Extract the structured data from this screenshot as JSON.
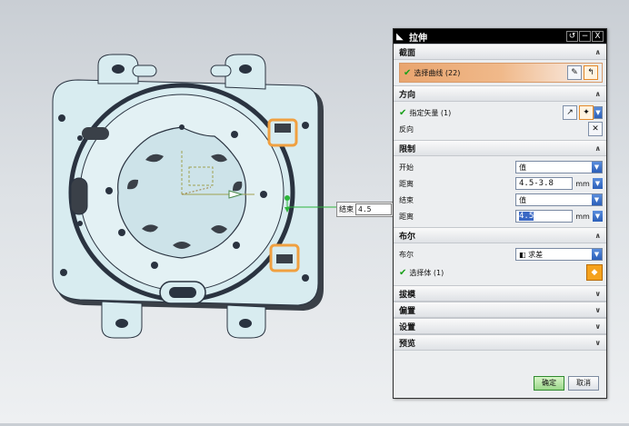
{
  "dialog": {
    "title": "拉伸",
    "title_buttons": {
      "reset": "↺",
      "minimize": "−",
      "close": "X"
    },
    "sections": {
      "section_curve": {
        "label": "截面",
        "selected_curve_label": "选择曲线 (22)"
      },
      "direction": {
        "label": "方向",
        "specify_vector_label": "指定矢量 (1)",
        "reverse_label": "反向"
      },
      "limits": {
        "label": "限制",
        "start_label": "开始",
        "start_value": "值",
        "start_distance_label": "距离",
        "start_distance_value": "4.5-3.8",
        "start_unit": "mm",
        "end_label": "结束",
        "end_value": "值",
        "end_distance_label": "距离",
        "end_distance_value": "4.5",
        "end_unit": "mm"
      },
      "boolean": {
        "label": "布尔",
        "boolean_label": "布尔",
        "boolean_value": "求差",
        "select_body_label": "选择体 (1)"
      },
      "draft": {
        "label": "拔模"
      },
      "offset": {
        "label": "偏置"
      },
      "settings": {
        "label": "设置"
      },
      "preview": {
        "label": "预览"
      }
    },
    "ok_label": "确定",
    "cancel_label": "取消"
  },
  "viewport": {
    "end_label": "结束",
    "end_value": "4.5"
  },
  "colors": {
    "part_fill": "#d8ecf0",
    "part_edge": "#2a3340",
    "highlight": "#f0a040",
    "vector": "#2cb53b"
  }
}
